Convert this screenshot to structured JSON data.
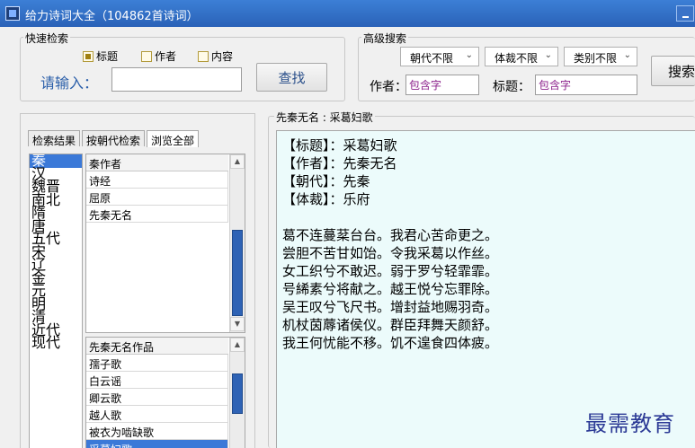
{
  "window": {
    "title": "给力诗词大全（104862首诗词）"
  },
  "quick_search": {
    "group_title": "快速检索",
    "options": [
      {
        "label": "标题",
        "checked": true
      },
      {
        "label": "作者",
        "checked": false
      },
      {
        "label": "内容",
        "checked": false
      }
    ],
    "prompt": "请输入：",
    "query_value": "",
    "search_button": "查找"
  },
  "advanced_search": {
    "group_title": "高级搜索",
    "dynasty_select": "朝代不限",
    "genre_select": "体裁不限",
    "category_select": "类别不限",
    "author_label": "作者：",
    "author_placeholder": "包含字",
    "title_label": "标题：",
    "title_placeholder": "包含字",
    "search_button": "搜索"
  },
  "tabs": [
    "检索结果",
    "按朝代检索",
    "浏览全部"
  ],
  "dynasties": [
    "秦",
    "汉",
    "魏晋",
    "南北",
    "隋",
    "唐",
    "五代",
    "宋",
    "辽",
    "金",
    "元",
    "明",
    "清",
    "近代",
    "现代"
  ],
  "authors_grid": {
    "header": "秦作者",
    "rows": [
      "诗经",
      "屈原",
      "先秦无名"
    ]
  },
  "works_grid": {
    "header": "先秦无名作品",
    "rows": [
      "孺子歌",
      "白云谣",
      "卿云歌",
      "越人歌",
      "被衣为啮缺歌",
      "采葛妇歌"
    ]
  },
  "poem": {
    "group_title": "先秦无名 : 采葛妇歌",
    "meta_lines": [
      "【标题】：采葛妇歌",
      "【作者】：先秦无名",
      "【朝代】：先秦",
      "【体裁】：乐府"
    ],
    "body_lines": [
      "葛不连蔓棻台台。我君心苦命更之。",
      "尝胆不苦甘如饴。令我采葛以作丝。",
      "女工织兮不敢迟。弱于罗兮轻霏霏。",
      "号絺素兮将献之。越王悦兮忘罪除。",
      "吴王叹兮飞尺书。增封益地赐羽奇。",
      "机杖茵蓐诸侯仪。群臣拜舞天颜舒。",
      "我王何忧能不移。饥不遑食四体疲。"
    ]
  },
  "watermark": "最需教育",
  "colors": {
    "titlebar": "#2a62b8",
    "selection": "#3b79d8",
    "content_bg": "#ecfbfb",
    "accent_blue": "#2a5ea9"
  }
}
